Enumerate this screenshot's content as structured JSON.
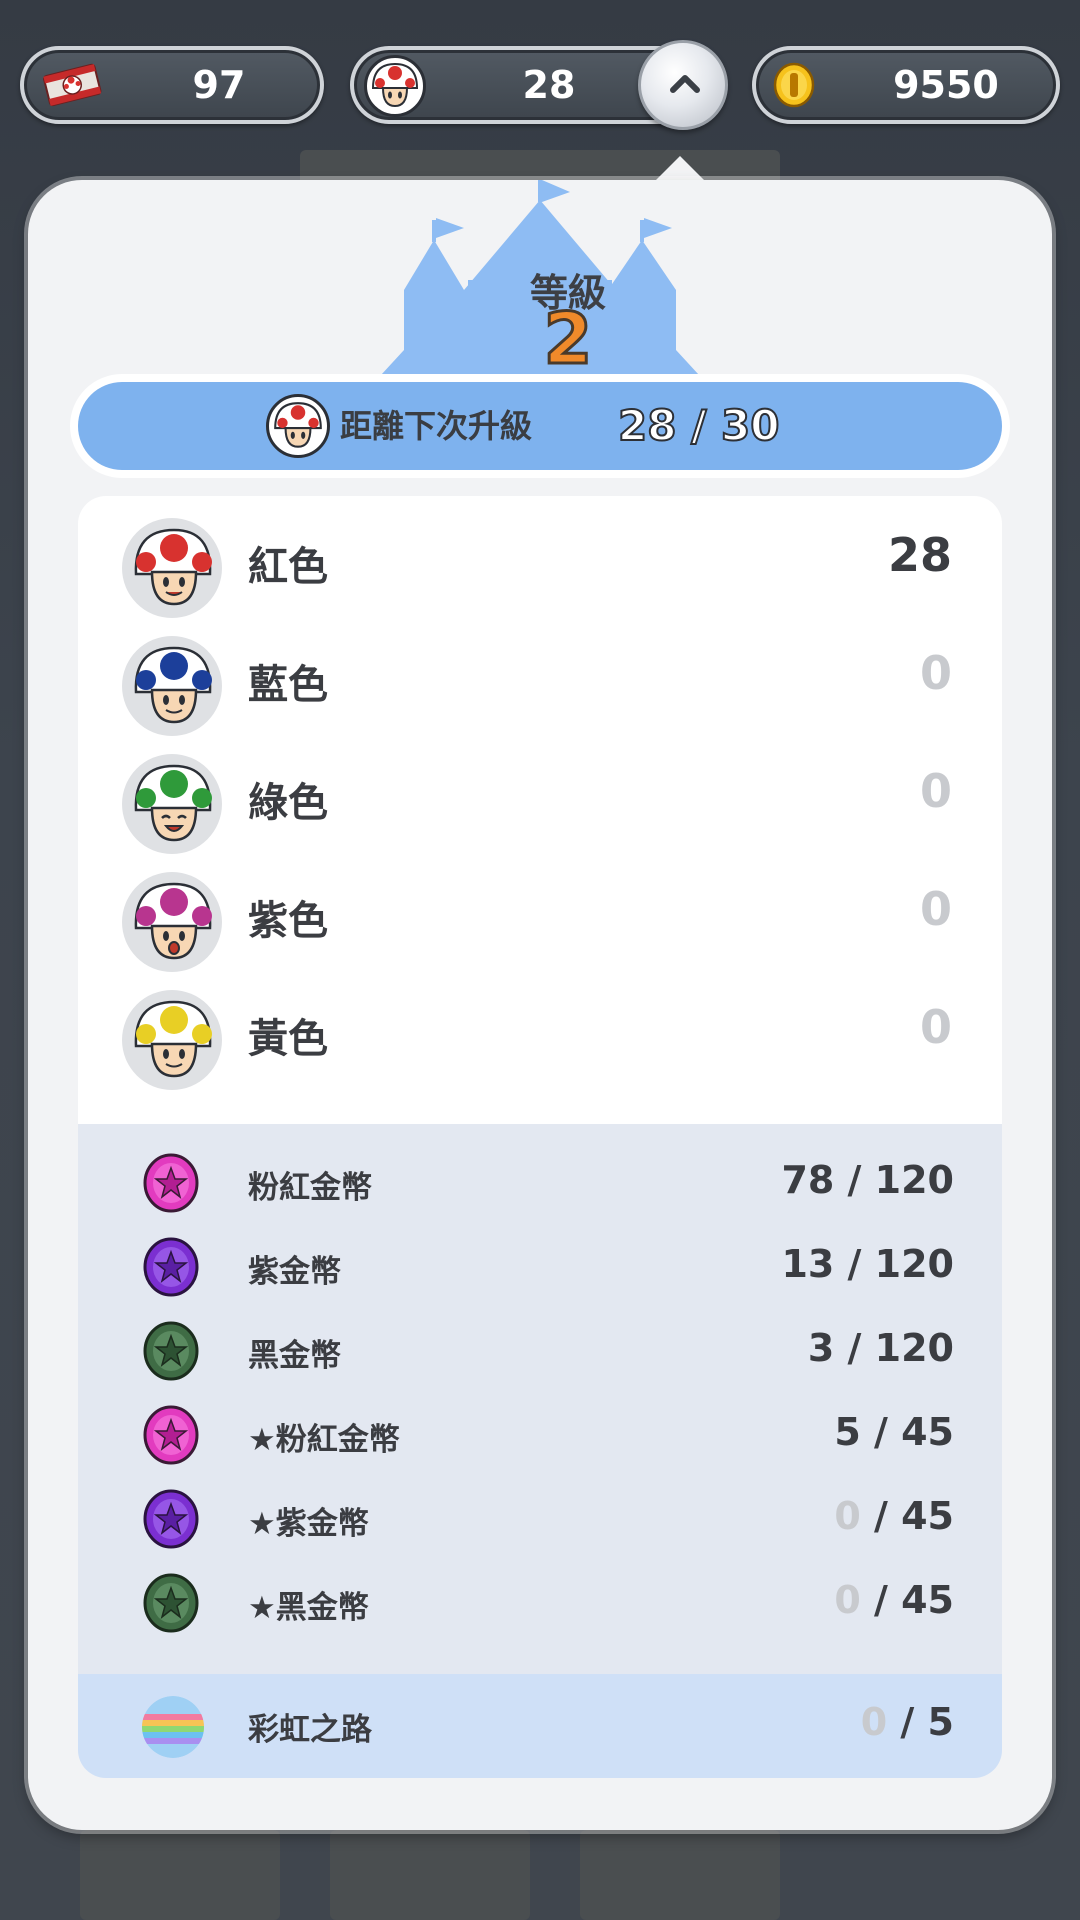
{
  "topbar": {
    "tickets": "97",
    "toads": "28",
    "coins": "9550"
  },
  "level": {
    "title": "等級",
    "value": "2"
  },
  "progress": {
    "label": "距離下次升級",
    "current": "28",
    "separator": "/",
    "target": "30"
  },
  "toads": [
    {
      "name": "紅色",
      "count": "28",
      "color": "#d8322f"
    },
    {
      "name": "藍色",
      "count": "0",
      "color": "#1c3f9a"
    },
    {
      "name": "綠色",
      "count": "0",
      "color": "#2f9a3a"
    },
    {
      "name": "紫色",
      "count": "0",
      "color": "#b8358f"
    },
    {
      "name": "黃色",
      "count": "0",
      "color": "#e8cf25"
    }
  ],
  "coins": [
    {
      "name": "粉紅金幣",
      "have": "78",
      "total": "120",
      "color": "#e23bbf"
    },
    {
      "name": "紫金幣",
      "have": "13",
      "total": "120",
      "color": "#7b2fd1"
    },
    {
      "name": "黑金幣",
      "have": "3",
      "total": "120",
      "color": "#3f6c45"
    },
    {
      "name": "★粉紅金幣",
      "have": "5",
      "total": "45",
      "color": "#e23bbf"
    },
    {
      "name": "★紫金幣",
      "have": "0",
      "total": "45",
      "color": "#7b2fd1"
    },
    {
      "name": "★黑金幣",
      "have": "0",
      "total": "45",
      "color": "#3f6c45"
    }
  ],
  "rainbow": {
    "name": "彩虹之路",
    "have": "0",
    "total": "5"
  },
  "icons": {
    "ticket": "toad-ticket-icon",
    "toad": "toad-head-icon",
    "coin": "gold-coin-icon",
    "collapse": "chevron-up-icon"
  }
}
